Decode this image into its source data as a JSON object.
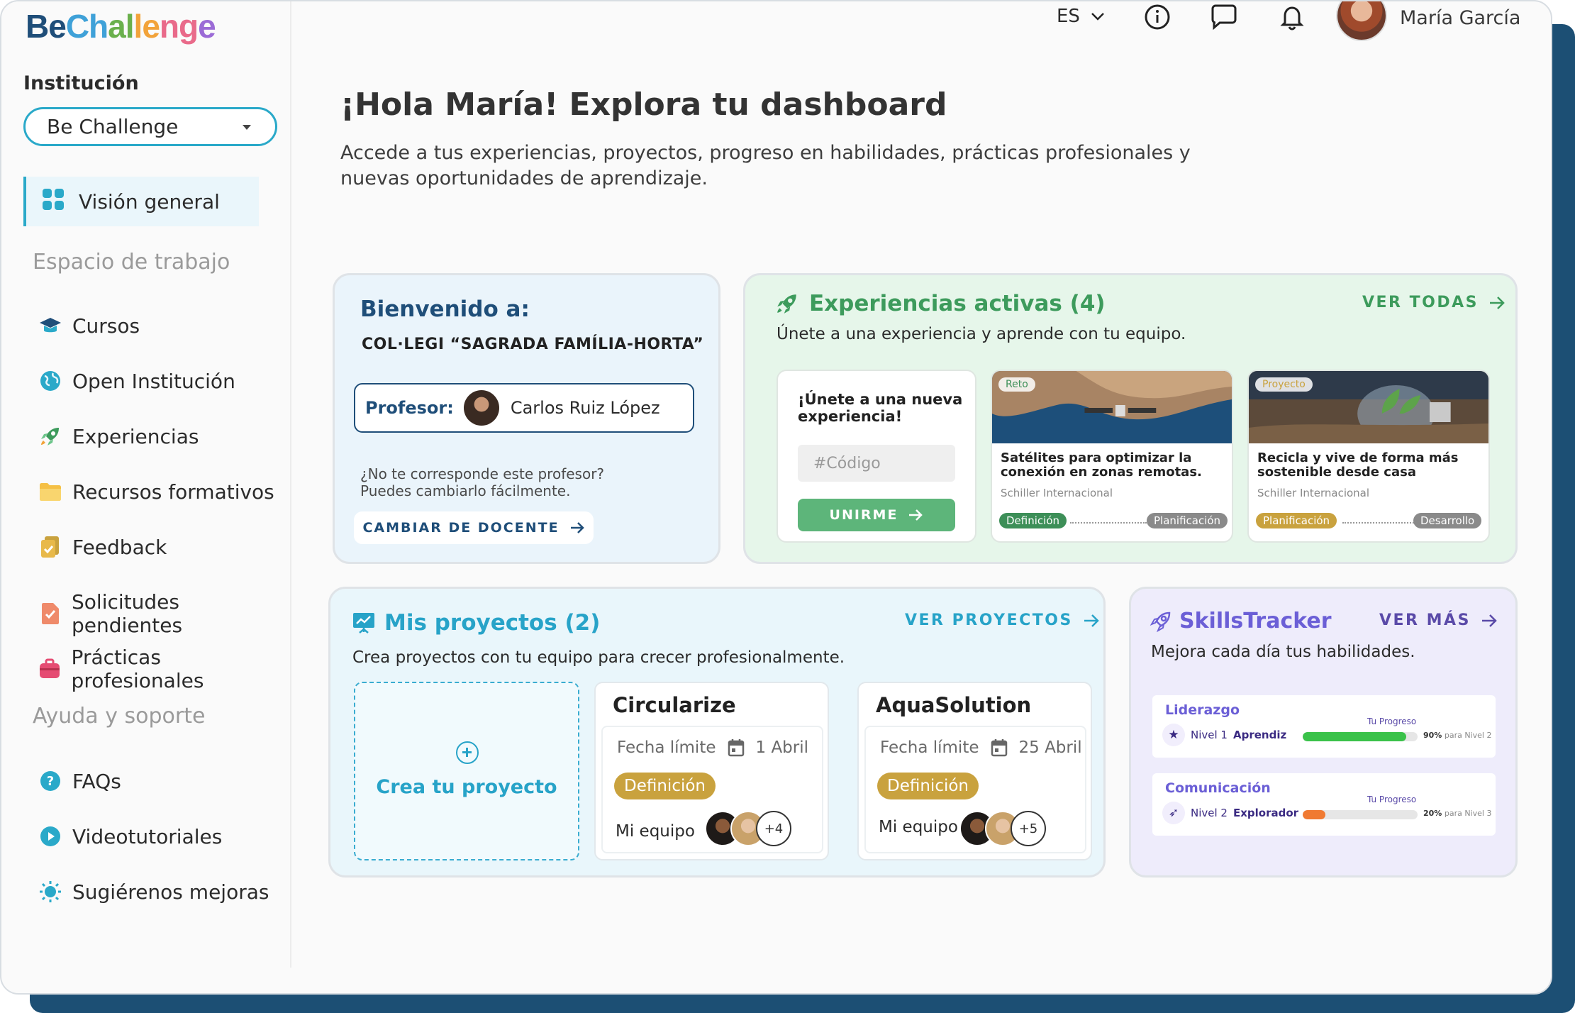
{
  "brand": {
    "be": "Be",
    "challenge": [
      "C",
      "h",
      "a",
      "l",
      "l",
      "e",
      "n",
      "g",
      "e"
    ]
  },
  "sidebar": {
    "institution_label": "Institución",
    "institution_value": "Be Challenge",
    "active_item": "Visión general",
    "workspace_title": "Espacio de trabajo",
    "workspace_items": [
      "Cursos",
      "Open Institución",
      "Experiencias",
      "Recursos formativos",
      "Feedback",
      "Solicitudes pendientes",
      "Prácticas profesionales"
    ],
    "help_title": "Ayuda y soporte",
    "help_items": [
      "FAQs",
      "Videotutoriales",
      "Sugiérenos mejoras"
    ]
  },
  "topbar": {
    "language": "ES",
    "user_name": "María García",
    "icons": [
      "info-icon",
      "chat-icon",
      "bell-icon"
    ]
  },
  "hero": {
    "title": "¡Hola María! Explora tu dashboard",
    "subtitle": "Accede a tus experiencias, proyectos, progreso en habilidades, prácticas profesionales y nuevas oportunidades de aprendizaje."
  },
  "welcome": {
    "title": "Bienvenido a:",
    "school": "COL·LEGI “SAGRADA FAMÍLIA-HORTA”",
    "teacher_label": "Profesor:",
    "teacher_name": "Carlos Ruiz López",
    "note_line1": "¿No te corresponde este profesor?",
    "note_line2": "Puedes cambiarlo fácilmente.",
    "button": "CAMBIAR DE DOCENTE"
  },
  "experiences": {
    "title": "Experiencias activas (4)",
    "subtitle": "Únete a una experiencia y aprende con tu equipo.",
    "link": "VER TODAS",
    "join_title": "¡Únete a una nueva experiencia!",
    "code_placeholder": "#Código",
    "join_button": "UNIRME",
    "cards": [
      {
        "tag": "Reto",
        "title": "Satélites para optimizar la conexión en zonas remotas.",
        "org": "Schiller Internacional",
        "from": "Definición",
        "to": "Planificación",
        "from_color": "#3d8f58"
      },
      {
        "tag": "Proyecto",
        "title": "Recicla y vive de forma más sostenible desde casa",
        "org": "Schiller Internacional",
        "from": "Planificación",
        "to": "Desarrollo",
        "from_color": "#c9a23e"
      }
    ]
  },
  "projects": {
    "title": "Mis proyectos (2)",
    "subtitle": "Crea proyectos con tu equipo para crecer profesionalmente.",
    "link": "VER PROYECTOS",
    "create_label": "Crea tu proyecto",
    "items": [
      {
        "name": "Circularize",
        "deadline_label": "Fecha límite",
        "deadline": "1 Abril",
        "stage": "Definición",
        "team_label": "Mi equipo",
        "more": "+4"
      },
      {
        "name": "AquaSolution",
        "deadline_label": "Fecha límite",
        "deadline": "25 Abril",
        "stage": "Definición",
        "team_label": "Mi equipo",
        "more": "+5"
      }
    ]
  },
  "skills": {
    "title": "SkillsTracker",
    "link": "VER MÁS",
    "subtitle": "Mejora cada día tus habilidades.",
    "items": [
      {
        "name": "Liderazgo",
        "level_prefix": "Nivel 1",
        "level": "Aprendiz",
        "progress_label": "Tu Progreso",
        "percent": "90%",
        "next": "para Nivel 2",
        "progress": 0.9,
        "color": "#3ac24a"
      },
      {
        "name": "Comunicación",
        "level_prefix": "Nivel 2",
        "level": "Explorador",
        "progress_label": "Tu Progreso",
        "percent": "20%",
        "next": "para Nivel 3",
        "progress": 0.2,
        "color": "#f07a32"
      }
    ]
  }
}
